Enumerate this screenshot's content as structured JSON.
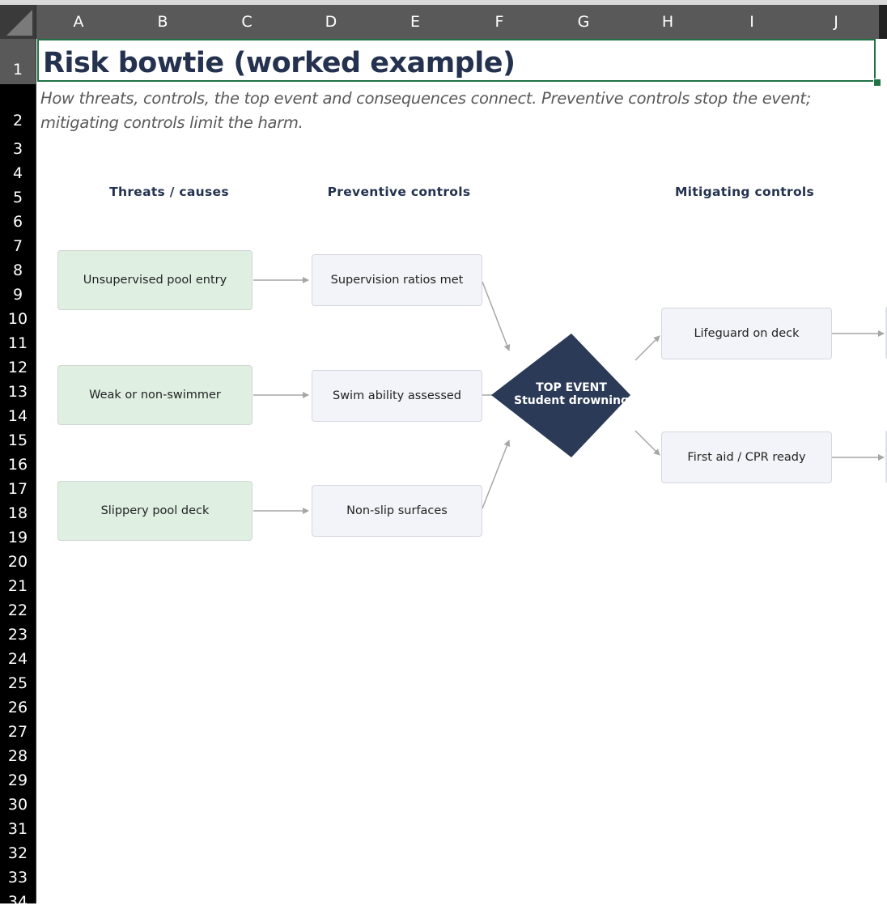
{
  "spreadsheet": {
    "columns": [
      "A",
      "B",
      "C",
      "D",
      "E",
      "F",
      "G",
      "H",
      "I",
      "J"
    ],
    "rows": [
      "1",
      "2",
      "3",
      "4",
      "5",
      "6",
      "7",
      "8",
      "9",
      "10",
      "11",
      "12",
      "13",
      "14",
      "15",
      "16",
      "17",
      "18",
      "19",
      "20",
      "21",
      "22",
      "23",
      "24",
      "25",
      "26",
      "27",
      "28",
      "29",
      "30",
      "31",
      "32",
      "33",
      "34"
    ],
    "selected_cell": "A1"
  },
  "sheet": {
    "title": "Risk bowtie (worked example)",
    "subtitle": "How threats, controls, the top event and consequences connect. Preventive controls stop the event; mitigating controls limit the harm."
  },
  "bowtie": {
    "headers": {
      "threats": "Threats / causes",
      "preventive": "Preventive controls",
      "mitigating": "Mitigating controls"
    },
    "threats": [
      "Unsupervised pool entry",
      "Weak or non-swimmer",
      "Slippery pool deck"
    ],
    "preventive_controls": [
      "Supervision ratios met",
      "Swim ability assessed",
      "Non-slip surfaces"
    ],
    "top_event": {
      "label": "TOP EVENT",
      "name": "Student drowning"
    },
    "mitigating_controls": [
      "Lifeguard on deck",
      "First aid / CPR ready"
    ],
    "colors": {
      "threat_fill": "#dff0e3",
      "control_fill": "#f3f4f9",
      "top_event_fill": "#2b3a57",
      "heading_text": "#24324f",
      "selection": "#217346",
      "arrow": "#a6a6a6"
    }
  }
}
